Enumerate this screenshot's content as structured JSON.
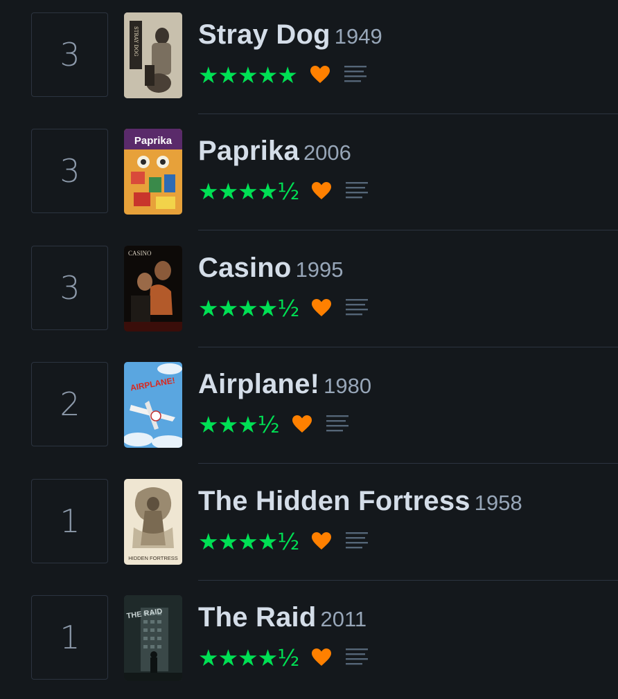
{
  "films": [
    {
      "count": "3",
      "title": "Stray Dog",
      "year": "1949",
      "rating": "★★★★★",
      "rating_value": 5,
      "liked": true,
      "has_review": true,
      "poster_text": "STRAY DOG"
    },
    {
      "count": "3",
      "title": "Paprika",
      "year": "2006",
      "rating": "★★★★½",
      "rating_value": 4.5,
      "liked": true,
      "has_review": true,
      "poster_text": "Paprika"
    },
    {
      "count": "3",
      "title": "Casino",
      "year": "1995",
      "rating": "★★★★½",
      "rating_value": 4.5,
      "liked": true,
      "has_review": true,
      "poster_text": "CASINO"
    },
    {
      "count": "2",
      "title": "Airplane!",
      "year": "1980",
      "rating": "★★★½",
      "rating_value": 3.5,
      "liked": true,
      "has_review": true,
      "poster_text": "AIRPLANE!"
    },
    {
      "count": "1",
      "title": "The Hidden Fortress",
      "year": "1958",
      "rating": "★★★★½",
      "rating_value": 4.5,
      "liked": true,
      "has_review": true,
      "poster_text": "HIDDEN FORTRESS"
    },
    {
      "count": "1",
      "title": "The Raid",
      "year": "2011",
      "rating": "★★★★½",
      "rating_value": 4.5,
      "liked": true,
      "has_review": true,
      "poster_text": "THE RAID"
    }
  ],
  "colors": {
    "background": "#14181c",
    "rating_green": "#00e054",
    "like_orange": "#ff8000",
    "title": "#d4dde8",
    "year": "#97a6b8",
    "divider": "#2c3440"
  },
  "icons": {
    "like": "heart-icon",
    "review": "review-lines-icon"
  }
}
